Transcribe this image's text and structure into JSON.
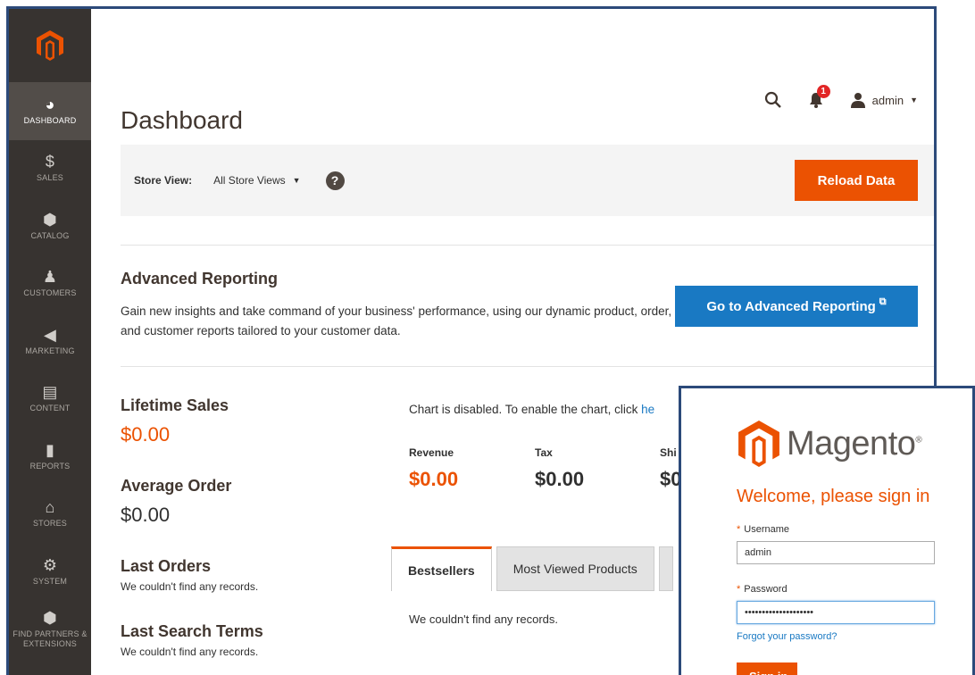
{
  "sidebar": {
    "items": [
      {
        "label": "DASHBOARD",
        "icon": "dashboard-gauge-icon",
        "glyph": "◕"
      },
      {
        "label": "SALES",
        "icon": "dollar-icon",
        "glyph": "$"
      },
      {
        "label": "CATALOG",
        "icon": "cube-icon",
        "glyph": "⬢"
      },
      {
        "label": "CUSTOMERS",
        "icon": "person-icon",
        "glyph": "♟"
      },
      {
        "label": "MARKETING",
        "icon": "megaphone-icon",
        "glyph": "◀"
      },
      {
        "label": "CONTENT",
        "icon": "layout-icon",
        "glyph": "▤"
      },
      {
        "label": "REPORTS",
        "icon": "bar-chart-icon",
        "glyph": "▮"
      },
      {
        "label": "STORES",
        "icon": "storefront-icon",
        "glyph": "⌂"
      },
      {
        "label": "SYSTEM",
        "icon": "gear-icon",
        "glyph": "⚙"
      },
      {
        "label": "FIND PARTNERS & EXTENSIONS",
        "icon": "box-icon",
        "glyph": "⬢"
      }
    ]
  },
  "header": {
    "title": "Dashboard",
    "notification_count": "1",
    "user_name": "admin"
  },
  "store_bar": {
    "label": "Store View:",
    "selected": "All Store Views",
    "reload_label": "Reload Data"
  },
  "advanced_reporting": {
    "title": "Advanced Reporting",
    "description": "Gain new insights and take command of your business' performance, using our dynamic product, order, and customer reports tailored to your customer data.",
    "button_label": "Go to Advanced Reporting"
  },
  "stats": {
    "lifetime_sales_title": "Lifetime Sales",
    "lifetime_sales_value": "$0.00",
    "average_order_title": "Average Order",
    "average_order_value": "$0.00",
    "last_orders_title": "Last Orders",
    "last_orders_note": "We couldn't find any records.",
    "last_search_title": "Last Search Terms",
    "last_search_note": "We couldn't find any records."
  },
  "chart_panel": {
    "disabled_text": "Chart is disabled. To enable the chart, click ",
    "link_text": "he",
    "metrics": [
      {
        "label": "Revenue",
        "value": "$0.00"
      },
      {
        "label": "Tax",
        "value": "$0.00"
      },
      {
        "label": "Shi",
        "value": "$0"
      }
    ]
  },
  "tabs": {
    "items": [
      "Bestsellers",
      "Most Viewed Products"
    ],
    "empty_text": "We couldn't find any records."
  },
  "login": {
    "brand": "Magento",
    "trademark": "®",
    "welcome": "Welcome, please sign in",
    "username_label": "Username",
    "username_value": "admin",
    "password_label": "Password",
    "password_mask": "••••••••••••••••••••",
    "forgot_link": "Forgot your password?",
    "sign_in_label": "Sign in"
  },
  "colors": {
    "accent": "#eb5202",
    "sidebar_bg": "#373330",
    "link_blue": "#1979c3",
    "frame_border": "#2c4a7a"
  }
}
